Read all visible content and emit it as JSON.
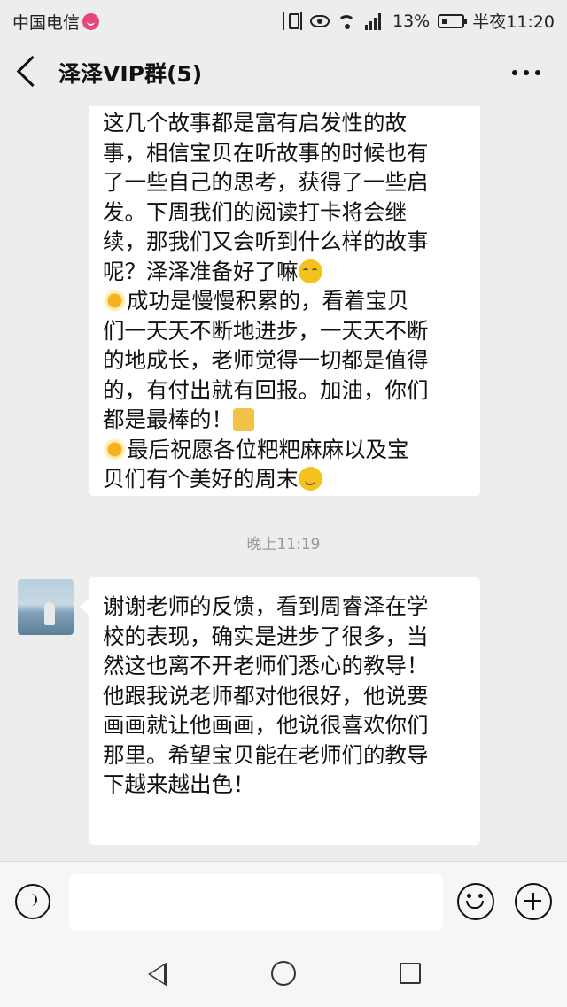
{
  "status_bar": {
    "carrier": "中国电信",
    "battery_percent": "13%",
    "time": "半夜11:20"
  },
  "header": {
    "title": "泽泽VIP群(5)"
  },
  "messages": [
    {
      "lines": [
        "这几个故事都是富有启发性的故",
        "事，相信宝贝在听故事的时候也有",
        "了一些自己的思考，获得了一些启",
        "发。下周我们的阅读打卡将会继",
        "续，那我们又会听到什么样的故事",
        "呢？泽泽准备好了嘛",
        "成功是慢慢积累的，看着宝贝",
        "们一天天不断地进步，一天天不断",
        "的地成长，老师觉得一切都是值得",
        "的，有付出就有回报。加油，你们",
        "都是最棒的！",
        "最后祝愿各位粑粑麻麻以及宝",
        "贝们有个美好的周末"
      ]
    },
    {
      "lines": [
        "谢谢老师的反馈，看到周睿泽在学",
        "校的表现，确实是进步了很多，当",
        "然这也离不开老师们悉心的教导！",
        "他跟我说老师都对他很好，他说要",
        "画画就让他画画，他说很喜欢你们",
        "那里。希望宝贝能在老师们的教导",
        "下越来越出色！"
      ]
    }
  ],
  "timestamp": "晚上11:19",
  "icons": {
    "shy": "shy-emoji-icon",
    "sun": "sun-emoji-icon",
    "thumb": "thumbs-up-emoji-icon",
    "smile": "smile-emoji-icon"
  }
}
